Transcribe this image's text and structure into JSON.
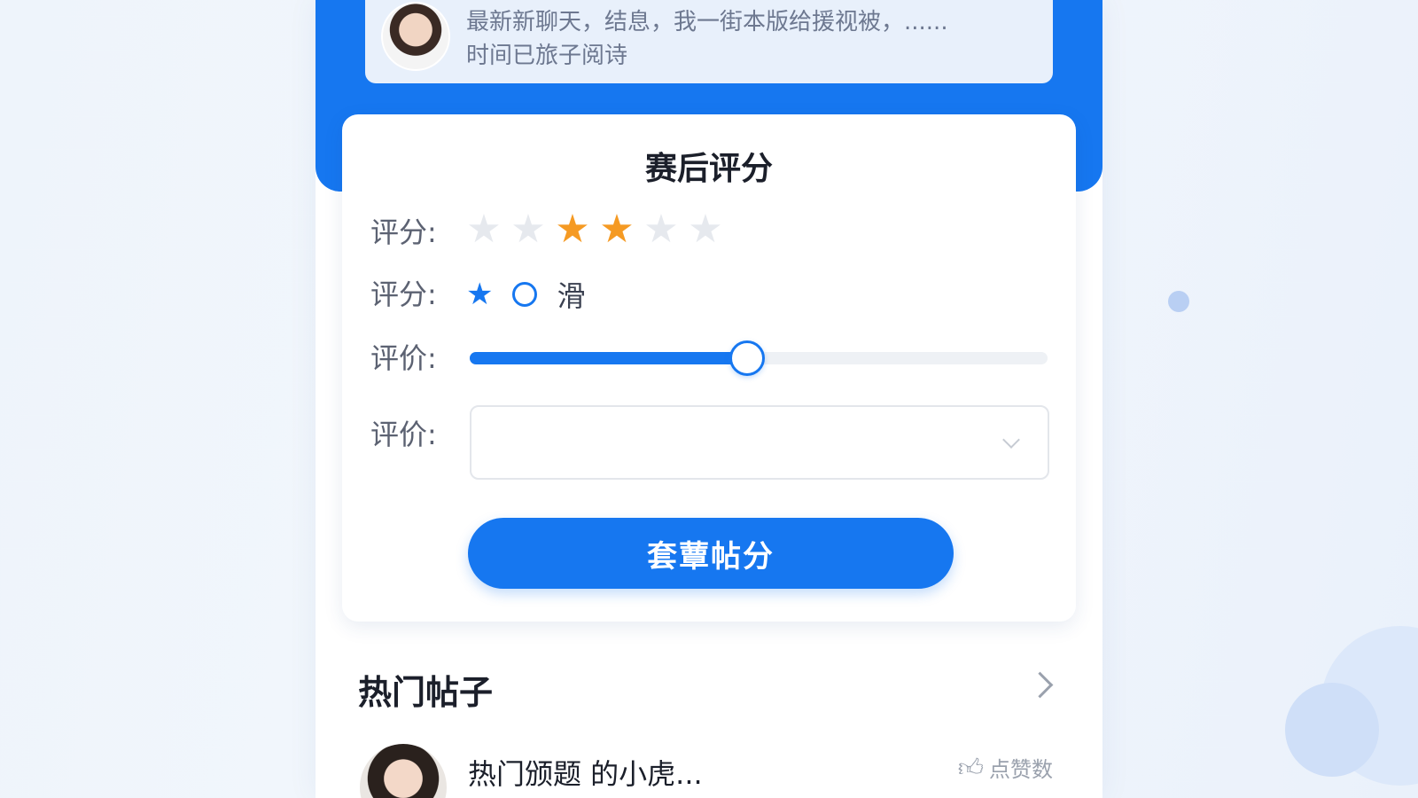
{
  "chat_preview": {
    "line1": "最新新聊天，结息，我一街本版给援视被，......",
    "line2": "时间已旅子阅诗"
  },
  "rating_form": {
    "title": "赛后评分",
    "score_label": "评分:",
    "stars": {
      "total": 6,
      "filled_positions": [
        3,
        4
      ]
    },
    "option_label": "评分:",
    "option_text": "滑",
    "slider_label": "评价:",
    "slider_value_fraction": 0.48,
    "select_label": "评价:",
    "select_value": "",
    "submit_label": "套蕈帖分"
  },
  "hot_posts": {
    "title": "热门帖子",
    "items": [
      {
        "title": "热门颁题  的小虎...",
        "like_label": "点赞数"
      }
    ]
  },
  "colors": {
    "primary": "#1677f0",
    "star_on": "#f59a23",
    "star_off": "#e6e9ee"
  }
}
